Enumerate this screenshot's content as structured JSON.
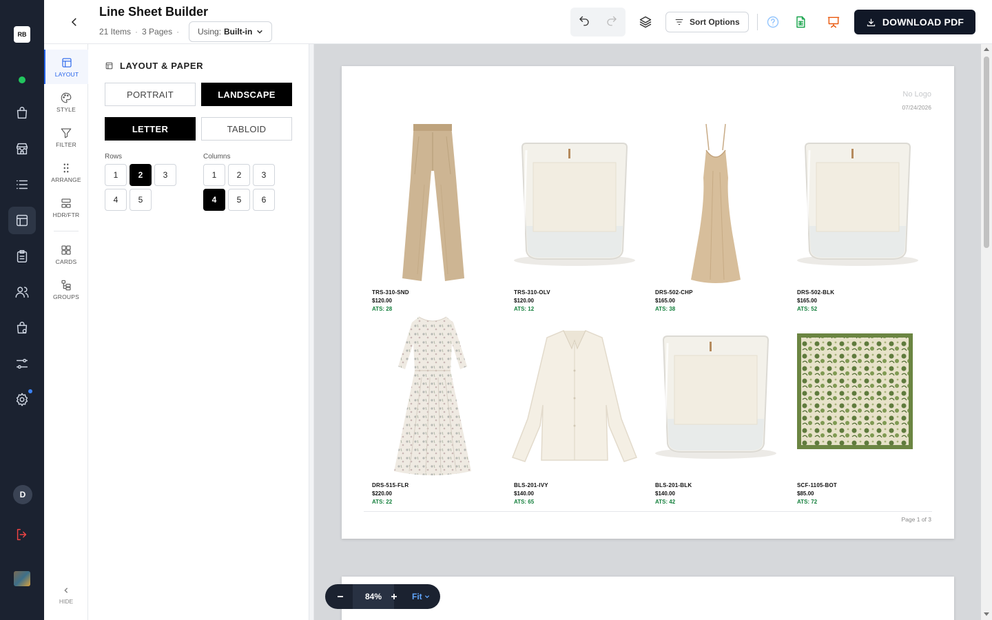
{
  "app": {
    "workspace_badge": "RB",
    "user_initial": "D"
  },
  "header": {
    "title": "Line Sheet Builder",
    "items": "21 Items",
    "pages": "3 Pages",
    "using_label": "Using:",
    "using_value": "Built-in",
    "sort_label": "Sort Options",
    "download_label": "DOWNLOAD PDF"
  },
  "tools": [
    {
      "label": "LAYOUT",
      "icon": "layout-icon",
      "active": true
    },
    {
      "label": "STYLE",
      "icon": "palette-icon"
    },
    {
      "label": "FILTER",
      "icon": "filter-icon"
    },
    {
      "label": "ARRANGE",
      "icon": "drag-icon"
    },
    {
      "label": "HDR/FTR",
      "icon": "header-footer-icon"
    },
    {
      "label": "CARDS",
      "icon": "cards-icon"
    },
    {
      "label": "GROUPS",
      "icon": "groups-icon"
    }
  ],
  "hide_label": "HIDE",
  "panel": {
    "title": "LAYOUT & PAPER",
    "orientation": {
      "portrait": "PORTRAIT",
      "landscape": "LANDSCAPE",
      "selected": "landscape"
    },
    "paper": {
      "letter": "LETTER",
      "tabloid": "TABLOID",
      "selected": "letter"
    },
    "rows_label": "Rows",
    "rows": [
      "1",
      "2",
      "3",
      "4",
      "5"
    ],
    "rows_selected": "2",
    "columns_label": "Columns",
    "columns": [
      "1",
      "2",
      "3",
      "4",
      "5",
      "6"
    ],
    "columns_selected": "4"
  },
  "page": {
    "logo_text": "No Logo",
    "date": "07/24/2026",
    "page_label": "Page 1 of 3"
  },
  "products": [
    {
      "sku": "TRS-310-SND",
      "price": "$120.00",
      "ats": "ATS: 28",
      "image": "pants"
    },
    {
      "sku": "TRS-310-OLV",
      "price": "$120.00",
      "ats": "ATS: 12",
      "image": "candle"
    },
    {
      "sku": "DRS-502-CHP",
      "price": "$165.00",
      "ats": "ATS: 38",
      "image": "slip-dress"
    },
    {
      "sku": "DRS-502-BLK",
      "price": "$165.00",
      "ats": "ATS: 52",
      "image": "candle"
    },
    {
      "sku": "DRS-515-FLR",
      "price": "$220.00",
      "ats": "ATS: 22",
      "image": "floral-dress"
    },
    {
      "sku": "BLS-201-IVY",
      "price": "$140.00",
      "ats": "ATS: 65",
      "image": "blouse"
    },
    {
      "sku": "BLS-201-BLK",
      "price": "$140.00",
      "ats": "ATS: 42",
      "image": "candle"
    },
    {
      "sku": "SCF-1105-BOT",
      "price": "$85.00",
      "ats": "ATS: 72",
      "image": "scarf"
    }
  ],
  "zoom": {
    "value": "84%",
    "fit_label": "Fit"
  },
  "colors": {
    "rail": "#1b2230",
    "accent": "#2563eb",
    "ats_green": "#15803d"
  }
}
